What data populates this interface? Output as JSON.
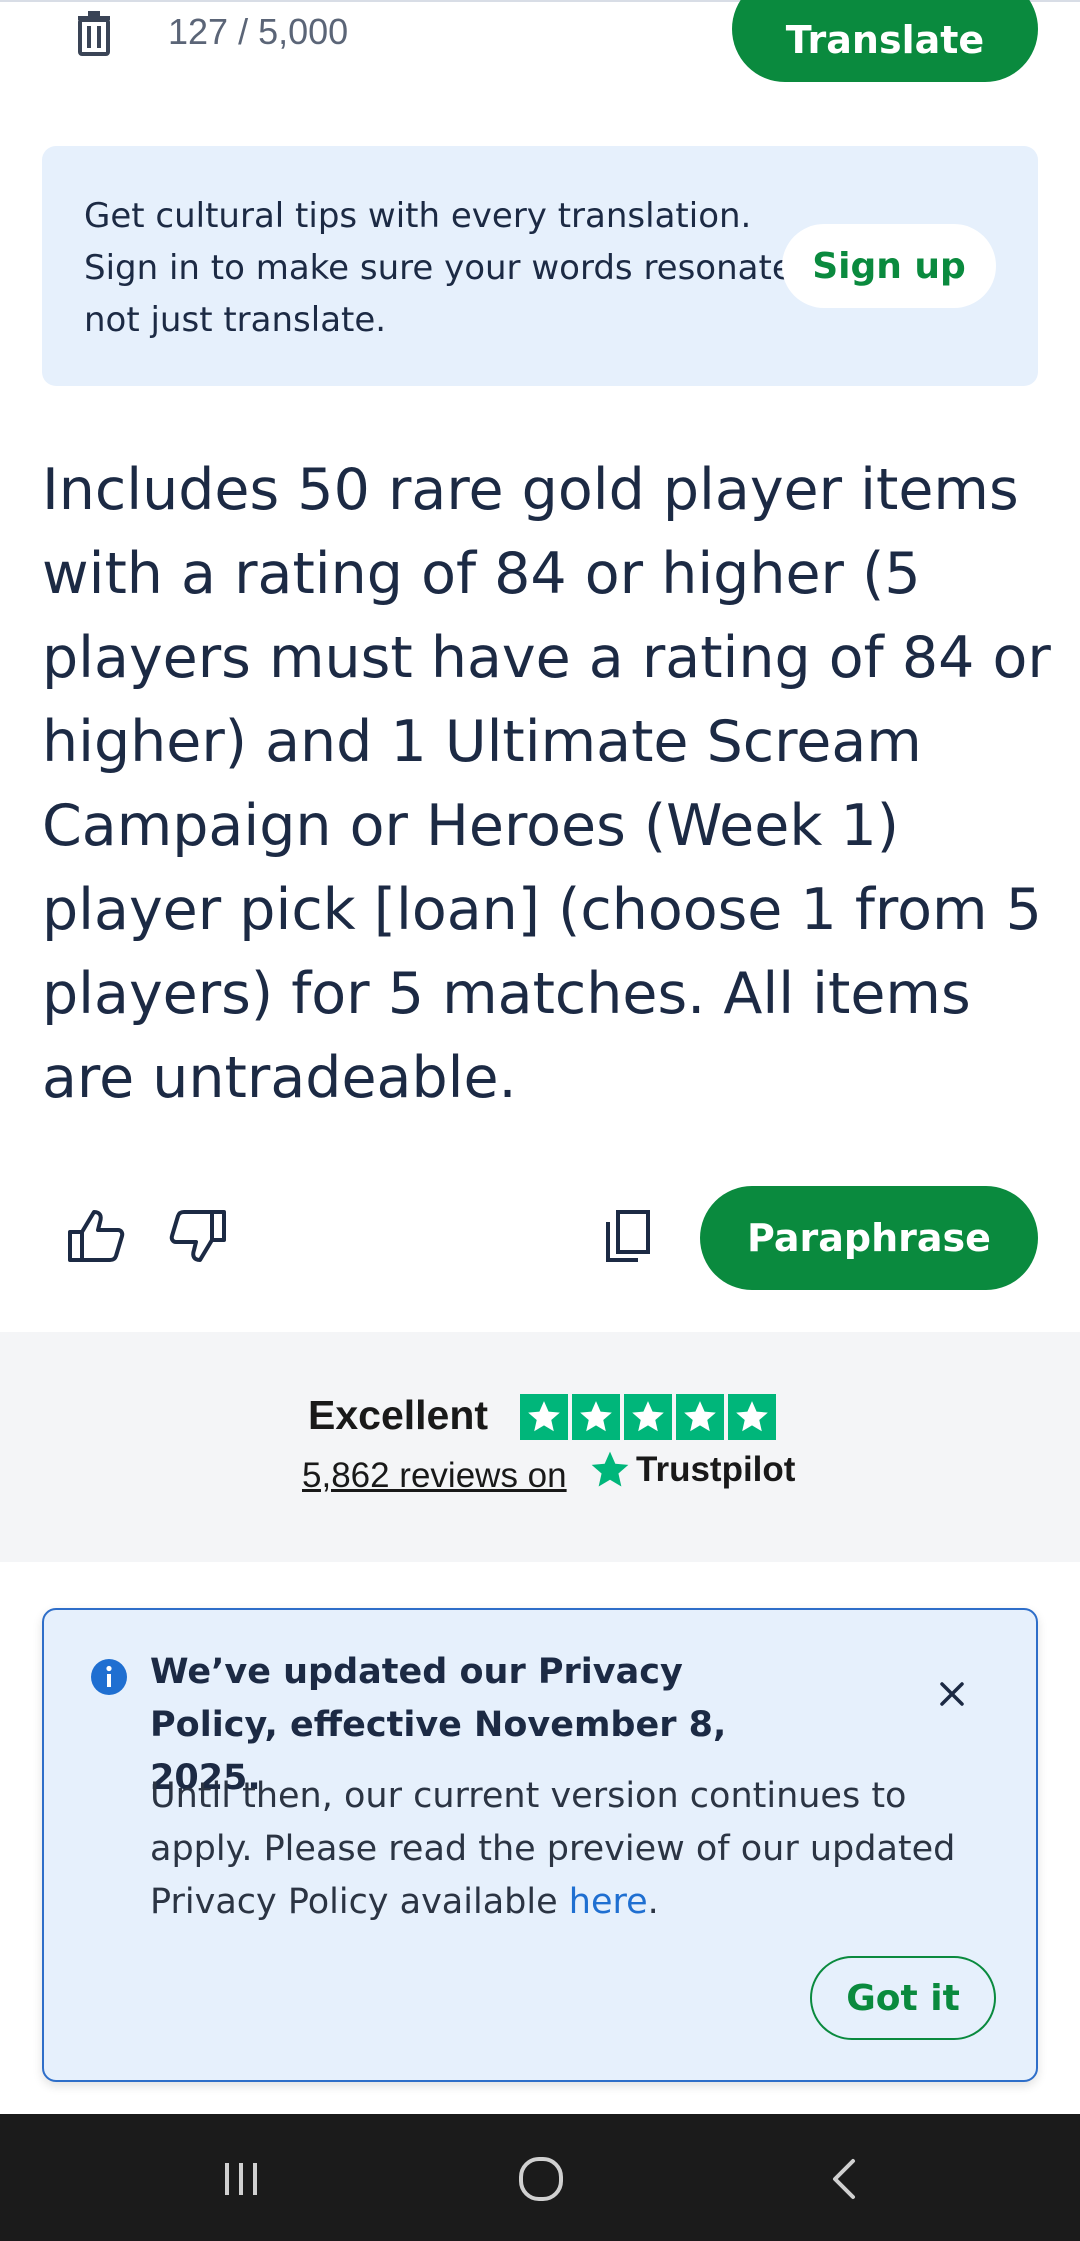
{
  "toolbar": {
    "char_count": "127 / 5,000",
    "translate_label": "Translate"
  },
  "tips_banner": {
    "text": "Get cultural tips with every translation. Sign in to make sure your words resonate, not just translate.",
    "signup_label": "Sign up"
  },
  "output": {
    "text": "Includes 50 rare gold player items with a rating of 84 or higher (5 players must have a rating of 84 or higher) and 1 Ultimate Scream Campaign or Heroes (Week 1) player pick [loan] (choose 1 from 5 players) for 5 matches. All items are untradeable."
  },
  "actions": {
    "icons": [
      "thumbs-up-icon",
      "thumbs-down-icon",
      "copy-icon"
    ],
    "paraphrase_label": "Paraphrase"
  },
  "trustpilot": {
    "rating_label": "Excellent",
    "stars": 5,
    "reviews_label": "5,862 reviews on",
    "brand": "Trustpilot",
    "star_color": "#00b67a"
  },
  "privacy_notice": {
    "title": "We’ve updated our Privacy Policy, effective November 8, 2025.",
    "body": "Until then, our current version continues to apply. Please read the preview of our updated Privacy Policy available",
    "link_label": "here",
    "body_end": ".",
    "gotit_label": "Got it"
  },
  "colors": {
    "accent_green": "#0a8a3e",
    "banner_bg": "#e6f0fc",
    "link_blue": "#1f6fd1",
    "text_dark": "#1c2a44"
  },
  "navbar": {
    "icons": [
      "recents-icon",
      "home-icon",
      "back-icon"
    ]
  }
}
